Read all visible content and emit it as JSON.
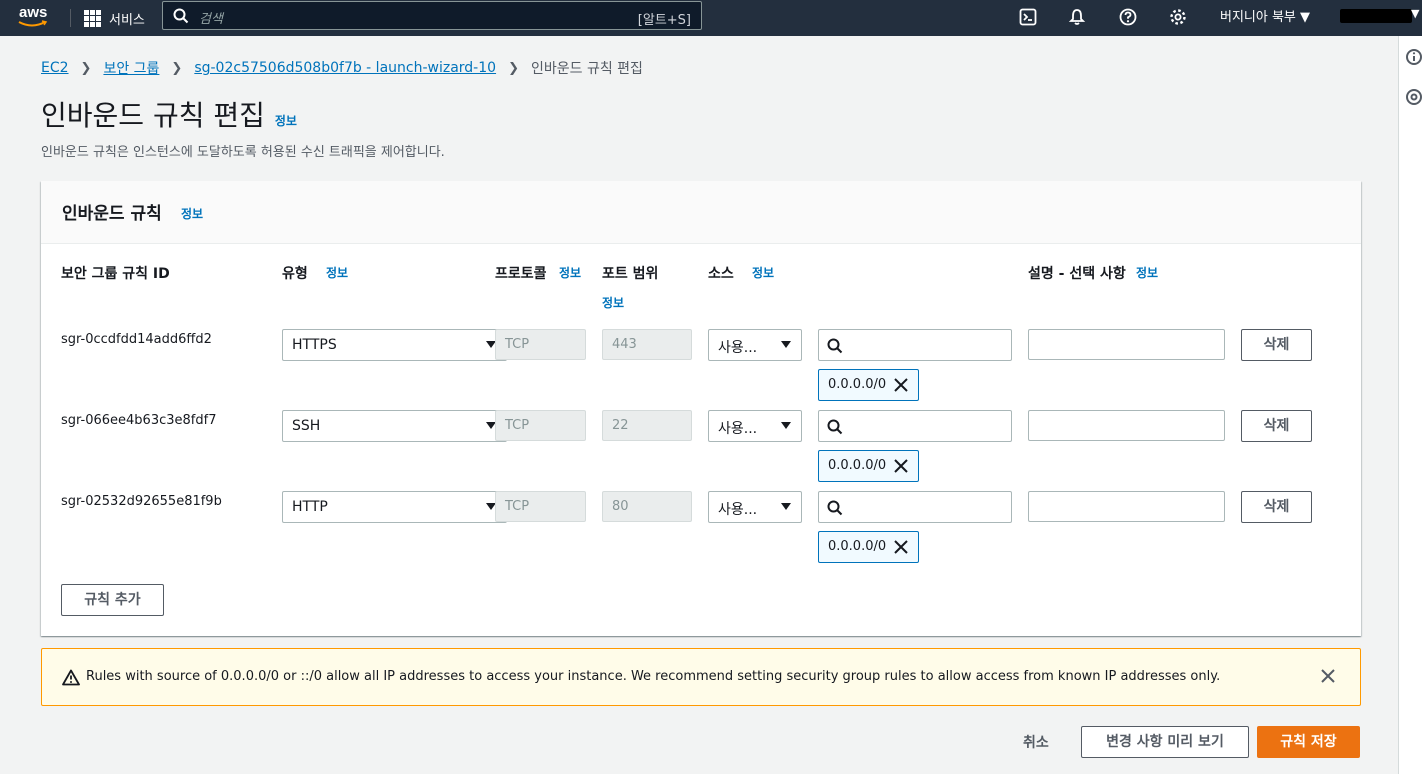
{
  "nav": {
    "logo": "aws",
    "services_label": "서비스",
    "search_placeholder": "검색",
    "search_shortcut": "[알트+S]",
    "region": "버지니아 북부 ▼",
    "icons": [
      "cloudshell-icon",
      "bell-icon",
      "help-icon",
      "settings-icon"
    ]
  },
  "breadcrumb": {
    "items": [
      "EC2",
      "보안 그룹",
      "sg-02c57506d508b0f7b - launch-wizard-10"
    ],
    "current": "인바운드 규칙 편집"
  },
  "page": {
    "title": "인바운드 규칙 편집",
    "info": "정보",
    "description": "인바운드 규칙은 인스턴스에 도달하도록 허용된 수신 트래픽을 제어합니다."
  },
  "container": {
    "title": "인바운드 규칙",
    "info": "정보"
  },
  "columns": {
    "rule_id": "보안 그룹 규칙 ID",
    "type": "유형",
    "protocol": "프로토콜",
    "port_range": "포트 범위",
    "source": "소스",
    "description": "설명 - 선택 사항",
    "info": "정보"
  },
  "rules": [
    {
      "id": "sgr-0ccdfdd14add6ffd2",
      "type": "HTTPS",
      "protocol": "TCP",
      "port": "443",
      "source_type": "사용...",
      "cidr": "0.0.0.0/0",
      "delete": "삭제"
    },
    {
      "id": "sgr-066ee4b63c3e8fdf7",
      "type": "SSH",
      "protocol": "TCP",
      "port": "22",
      "source_type": "사용...",
      "cidr": "0.0.0.0/0",
      "delete": "삭제"
    },
    {
      "id": "sgr-02532d92655e81f9b",
      "type": "HTTP",
      "protocol": "TCP",
      "port": "80",
      "source_type": "사용...",
      "cidr": "0.0.0.0/0",
      "delete": "삭제"
    }
  ],
  "add_rule": "규칙 추가",
  "warning": {
    "text": "Rules with source of 0.0.0.0/0 or ::/0 allow all IP addresses to access your instance. We recommend setting security group rules to allow access from known IP addresses only."
  },
  "footer": {
    "cancel": "취소",
    "preview": "변경 사항 미리 보기",
    "save": "규칙 저장"
  },
  "colors": {
    "nav_bg": "#232f3e",
    "link": "#0073bb",
    "primary": "#ec7211",
    "warning_border": "#ff9900"
  }
}
